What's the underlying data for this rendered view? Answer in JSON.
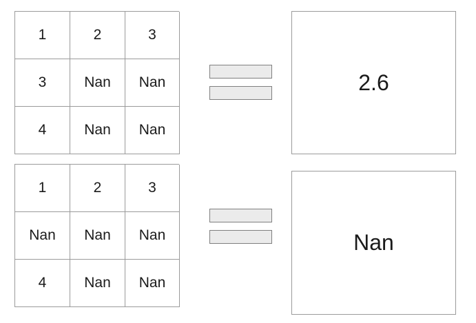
{
  "top": {
    "grid": [
      "1",
      "2",
      "3",
      "3",
      "Nan",
      "Nan",
      "4",
      "Nan",
      "Nan"
    ],
    "result": "2.6"
  },
  "bottom": {
    "grid": [
      "1",
      "2",
      "3",
      "Nan",
      "Nan",
      "Nan",
      "4",
      "Nan",
      "Nan"
    ],
    "result": "Nan"
  }
}
